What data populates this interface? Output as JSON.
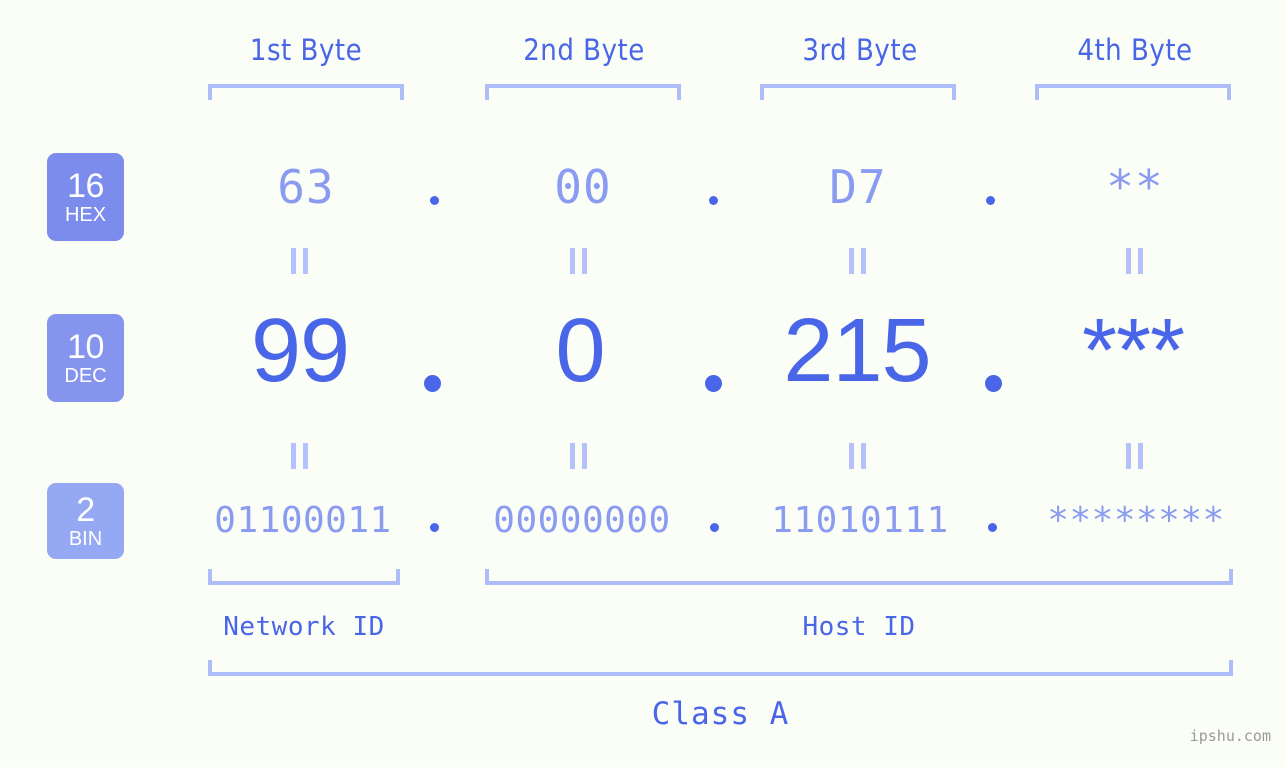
{
  "page": {
    "background_color": "#fbfdf7",
    "accent_color": "#4a66e8",
    "light_accent_color": "#8a9bf2",
    "bracket_color": "#aebdfa",
    "watermark": "ipshu.com"
  },
  "byte_headers": [
    {
      "label": "1st Byte"
    },
    {
      "label": "2nd Byte"
    },
    {
      "label": "3rd Byte"
    },
    {
      "label": "4th Byte"
    }
  ],
  "rows": [
    {
      "badge": {
        "number": "16",
        "system": "HEX",
        "color": "#7c8ced"
      },
      "values": [
        "63",
        "00",
        "D7",
        "**"
      ],
      "separator": "."
    },
    {
      "badge": {
        "number": "10",
        "system": "DEC",
        "color": "#8595ee"
      },
      "values": [
        "99",
        "0",
        "215",
        "***"
      ],
      "separator": "."
    },
    {
      "badge": {
        "number": "2",
        "system": "BIN",
        "color": "#94a8f3"
      },
      "values": [
        "01100011",
        "00000000",
        "11010111",
        "********"
      ],
      "separator": "."
    }
  ],
  "equals_marks": {
    "glyph": "||",
    "count_per_row": 4,
    "rows": 2
  },
  "id_sections": [
    {
      "label": "Network ID"
    },
    {
      "label": "Host ID"
    }
  ],
  "class_section": {
    "label": "Class A"
  }
}
